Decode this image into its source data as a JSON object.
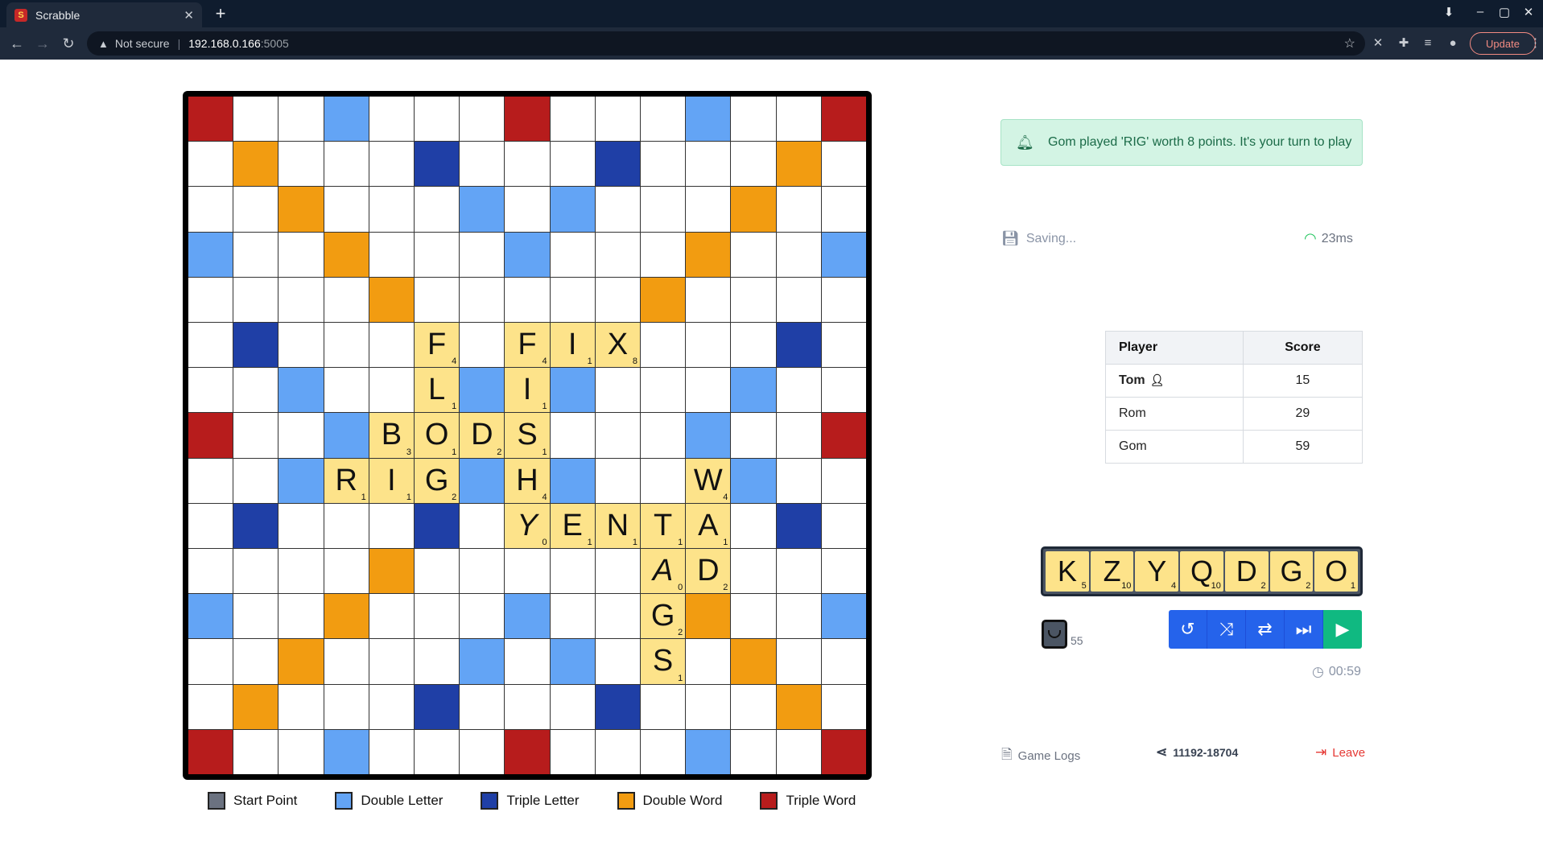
{
  "browser": {
    "tab_title": "Scrabble",
    "tab_favicon": "S",
    "url_warning": "Not secure",
    "url_host": "192.168.0.166",
    "url_port": ":5005",
    "update_label": "Update"
  },
  "colors": {
    "start": "#6b7280",
    "double_letter": "#63a4f5",
    "triple_letter": "#1f3fa6",
    "double_word": "#f29c11",
    "triple_word": "#b71c1c",
    "tile": "#fde38a",
    "notice_bg": "#d3f4e4",
    "action_blue": "#2563eb",
    "play_green": "#10b981",
    "leave_red": "#e53935"
  },
  "board": {
    "premium_rows": [
      "T  d   T   d  T",
      " D   t   t   D ",
      "  D   d d   D  ",
      "d  D   d   D  d",
      "    D     D    ",
      " t   t   t   t ",
      "  d   d d   d  ",
      "T  d   S   d  T",
      "  d   d d   d  ",
      " t   t   t   t ",
      "    D     D    ",
      "d  D   d   D  d",
      "  D   d d   D  ",
      " D   t   t   D ",
      "T  d   T   d  T"
    ],
    "tiles": [
      {
        "r": 5,
        "c": 5,
        "letter": "F",
        "pts": "4"
      },
      {
        "r": 5,
        "c": 7,
        "letter": "F",
        "pts": "4"
      },
      {
        "r": 5,
        "c": 8,
        "letter": "I",
        "pts": "1"
      },
      {
        "r": 5,
        "c": 9,
        "letter": "X",
        "pts": "8"
      },
      {
        "r": 6,
        "c": 5,
        "letter": "L",
        "pts": "1"
      },
      {
        "r": 6,
        "c": 7,
        "letter": "I",
        "pts": "1"
      },
      {
        "r": 7,
        "c": 4,
        "letter": "B",
        "pts": "3"
      },
      {
        "r": 7,
        "c": 5,
        "letter": "O",
        "pts": "1"
      },
      {
        "r": 7,
        "c": 6,
        "letter": "D",
        "pts": "2"
      },
      {
        "r": 7,
        "c": 7,
        "letter": "S",
        "pts": "1"
      },
      {
        "r": 8,
        "c": 3,
        "letter": "R",
        "pts": "1"
      },
      {
        "r": 8,
        "c": 4,
        "letter": "I",
        "pts": "1"
      },
      {
        "r": 8,
        "c": 5,
        "letter": "G",
        "pts": "2"
      },
      {
        "r": 8,
        "c": 7,
        "letter": "H",
        "pts": "4"
      },
      {
        "r": 8,
        "c": 11,
        "letter": "W",
        "pts": "4"
      },
      {
        "r": 9,
        "c": 7,
        "letter": "Y",
        "pts": "0",
        "blank": true
      },
      {
        "r": 9,
        "c": 8,
        "letter": "E",
        "pts": "1"
      },
      {
        "r": 9,
        "c": 9,
        "letter": "N",
        "pts": "1"
      },
      {
        "r": 9,
        "c": 10,
        "letter": "T",
        "pts": "1"
      },
      {
        "r": 9,
        "c": 11,
        "letter": "A",
        "pts": "1"
      },
      {
        "r": 10,
        "c": 10,
        "letter": "A",
        "pts": "0",
        "blank": true
      },
      {
        "r": 10,
        "c": 11,
        "letter": "D",
        "pts": "2"
      },
      {
        "r": 11,
        "c": 10,
        "letter": "G",
        "pts": "2"
      },
      {
        "r": 12,
        "c": 10,
        "letter": "S",
        "pts": "1"
      }
    ]
  },
  "legend": [
    {
      "label": "Start Point",
      "color": "#6b7280"
    },
    {
      "label": "Double Letter",
      "color": "#63a4f5"
    },
    {
      "label": "Triple Letter",
      "color": "#1f3fa6"
    },
    {
      "label": "Double Word",
      "color": "#f29c11"
    },
    {
      "label": "Triple Word",
      "color": "#b71c1c"
    }
  ],
  "notice": "Gom played 'RIG' worth 8 points. It's your turn to play",
  "status": {
    "saving": "Saving...",
    "ping": "23ms"
  },
  "scoreboard": {
    "headers": {
      "player": "Player",
      "score": "Score"
    },
    "rows": [
      {
        "player": "Tom",
        "score": "15",
        "is_me": true
      },
      {
        "player": "Rom",
        "score": "29"
      },
      {
        "player": "Gom",
        "score": "59"
      }
    ]
  },
  "rack": [
    {
      "letter": "K",
      "pts": "5"
    },
    {
      "letter": "Z",
      "pts": "10"
    },
    {
      "letter": "Y",
      "pts": "4"
    },
    {
      "letter": "Q",
      "pts": "10"
    },
    {
      "letter": "D",
      "pts": "2"
    },
    {
      "letter": "G",
      "pts": "2"
    },
    {
      "letter": "O",
      "pts": "1"
    }
  ],
  "bag_count": "55",
  "actions": [
    {
      "name": "undo-button",
      "icon": "↺"
    },
    {
      "name": "shuffle-button",
      "icon": "⤨"
    },
    {
      "name": "swap-button",
      "icon": "⇄"
    },
    {
      "name": "pass-button",
      "icon": "⏭"
    },
    {
      "name": "play-button",
      "icon": "▶"
    }
  ],
  "timer": "00:59",
  "footer": {
    "game_logs": "Game Logs",
    "game_id": "11192-18704",
    "leave": "Leave"
  }
}
